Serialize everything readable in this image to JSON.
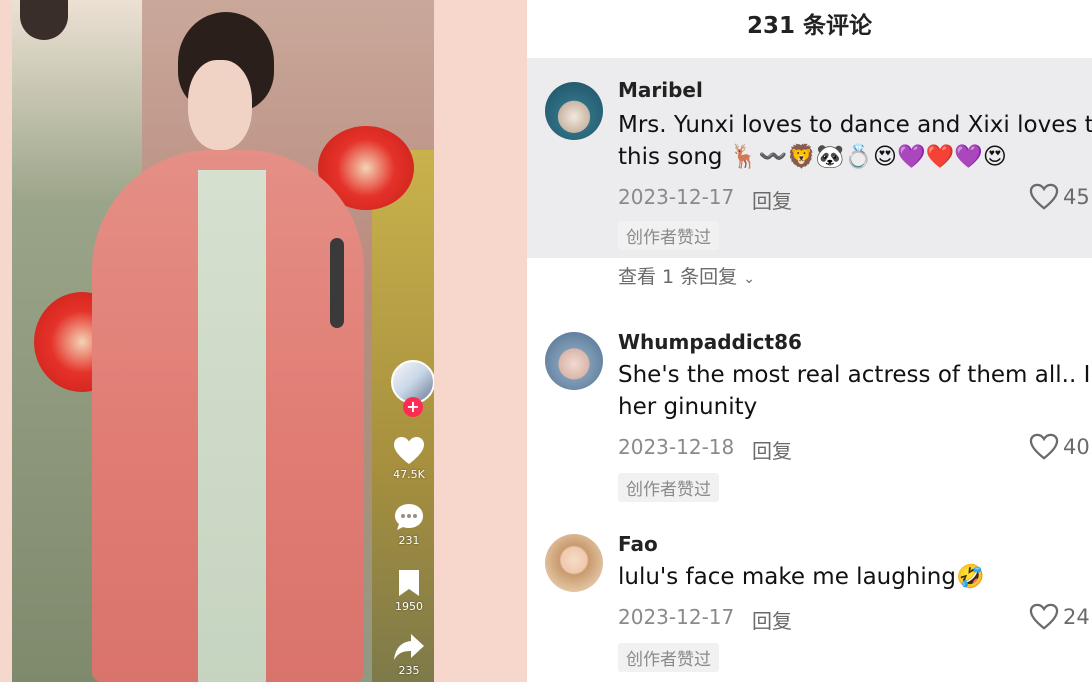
{
  "video": {
    "actions": [
      {
        "name": "like",
        "count": "47.5K"
      },
      {
        "name": "comment",
        "count": "231"
      },
      {
        "name": "save",
        "count": "1950"
      },
      {
        "name": "share",
        "count": "235"
      }
    ]
  },
  "comments_panel": {
    "title": "231 条评论",
    "view_replies": "查看 1 条回复",
    "comments": [
      {
        "user": "Maribel",
        "text_line1": "Mrs. Yunxi loves to dance and Xixi loves to",
        "text_line2": "this song 🦌〰️🦁🐼💍😍💜❤️💜😍",
        "date": "2023-12-17",
        "reply": "回复",
        "likes": "45",
        "badge": "创作者赞过"
      },
      {
        "user": "Whumpaddict86",
        "text_line1": "She's the most real actress of them all.. I lo",
        "text_line2": "her ginunity",
        "date": "2023-12-18",
        "reply": "回复",
        "likes": "40",
        "badge": "创作者赞过"
      },
      {
        "user": "Fao",
        "text_line1": "lulu's face make me laughing🤣",
        "date": "2023-12-17",
        "reply": "回复",
        "likes": "24",
        "badge": "创作者赞过"
      }
    ]
  }
}
